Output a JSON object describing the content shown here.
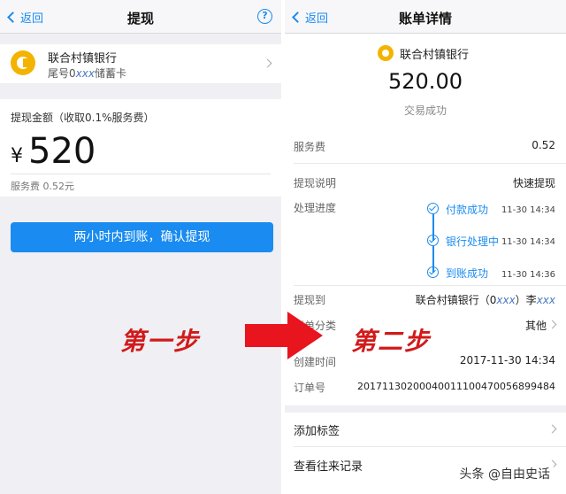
{
  "left": {
    "nav": {
      "back": "返回",
      "title": "提现",
      "help": "?"
    },
    "bank": {
      "name": "联合村镇银行",
      "sub": "尾号0",
      "sub_masked": "xxx",
      "sub_suffix": "储蓄卡"
    },
    "amount": {
      "label": "提现金额（收取0.1%服务费）",
      "currency": "¥",
      "value": "520",
      "fee_note": "服务费 0.52元"
    },
    "confirm_button": "两小时内到账，确认提现"
  },
  "right": {
    "nav": {
      "back": "返回",
      "title": "账单详情"
    },
    "merchant": {
      "name": "联合村镇银行",
      "amount": "520.00",
      "status": "交易成功"
    },
    "fee": {
      "label": "服务费",
      "value": "0.52"
    },
    "desc": {
      "label": "提现说明",
      "value": "快速提现"
    },
    "progress": {
      "label": "处理进度",
      "steps": [
        {
          "text": "付款成功",
          "time": "11-30 14:34"
        },
        {
          "text": "银行处理中",
          "time": "11-30 14:34"
        },
        {
          "text": "到账成功",
          "time": "11-30 14:36"
        }
      ]
    },
    "to": {
      "label": "提现到",
      "value_prefix": "联合村镇银行（0",
      "value_masked": "xxx",
      "value_mid": "）李",
      "value_masked2": "xxx"
    },
    "category": {
      "label": "账单分类",
      "value": "其他"
    },
    "created": {
      "label": "创建时间",
      "value": "2017-11-30 14:34"
    },
    "order": {
      "label": "订单号",
      "value": "20171130200040011100470056899484"
    },
    "add_tag": "添加标签",
    "history": "查看往来记录"
  },
  "annotations": {
    "step1": "第一步",
    "step2": "第二步"
  },
  "watermark": "头条 @自由史话",
  "colors": {
    "accent": "#1a8bf0",
    "arrow": "#e8141e",
    "bank_logo": "#f4b300"
  }
}
